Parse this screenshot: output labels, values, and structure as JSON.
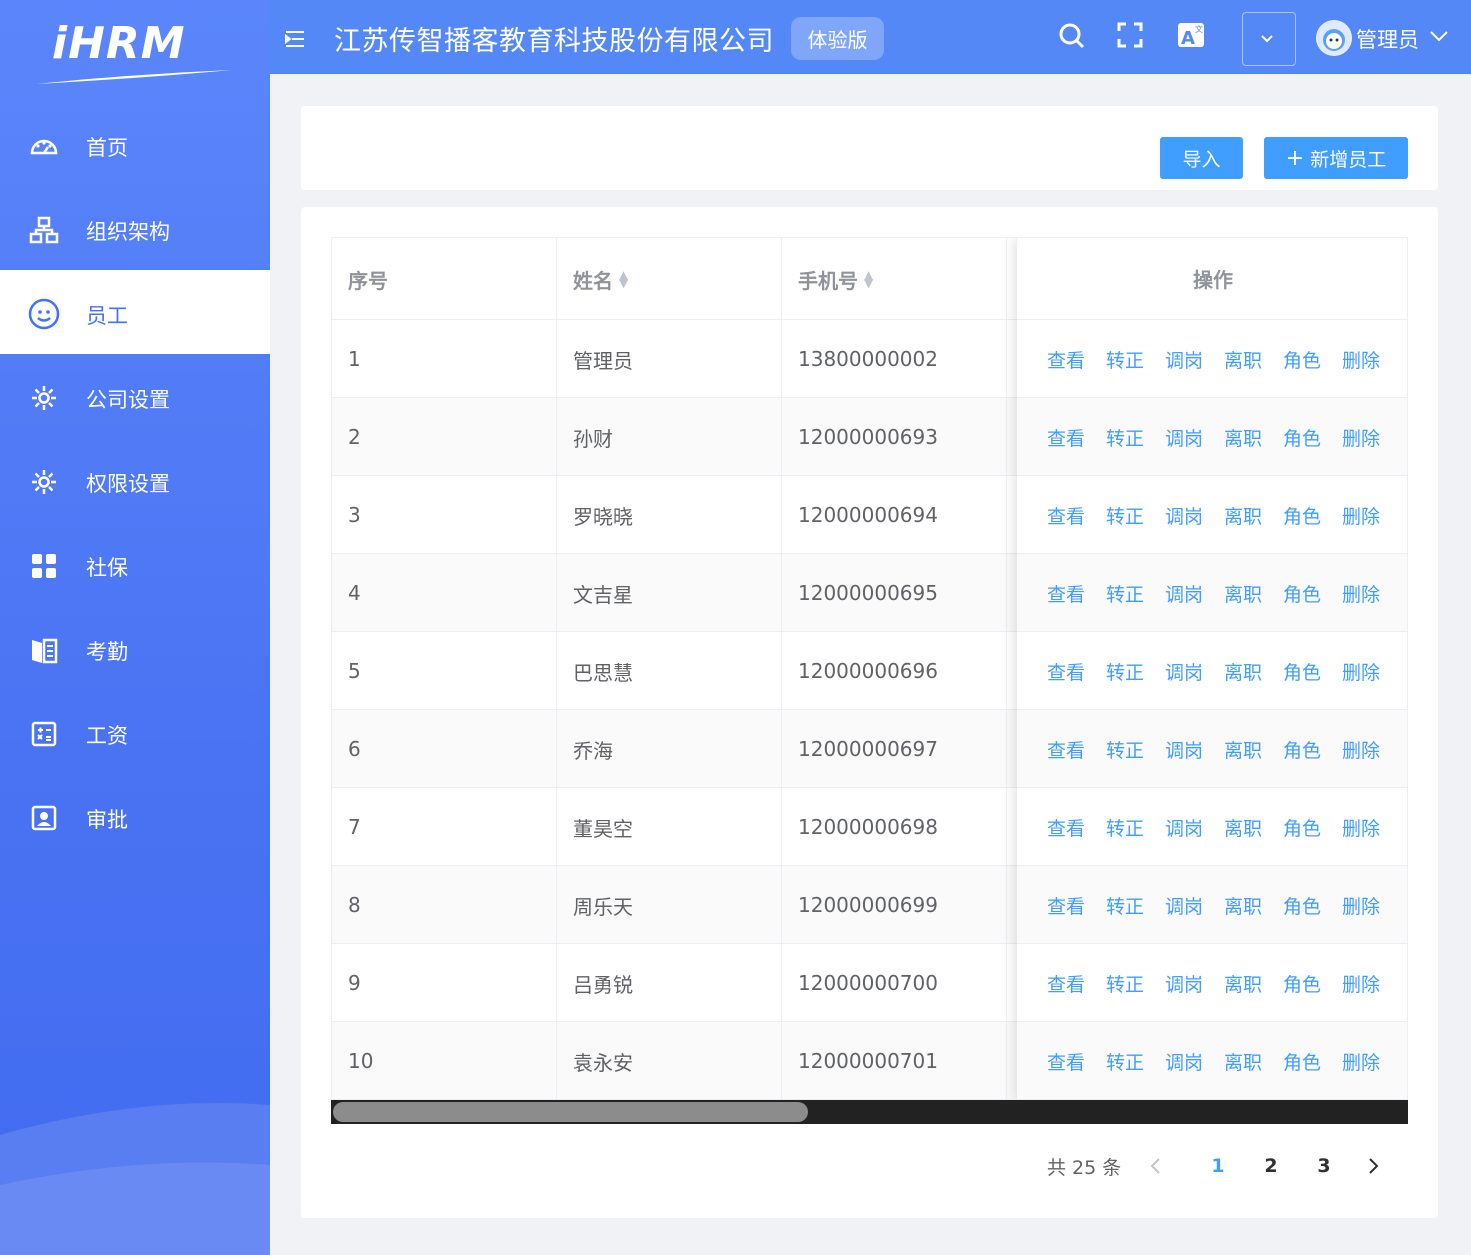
{
  "sidebar": {
    "logo_text": "iHRM",
    "items": [
      {
        "label": "首页",
        "icon": "dashboard-icon"
      },
      {
        "label": "组织架构",
        "icon": "org-chart-icon"
      },
      {
        "label": "员工",
        "icon": "people-icon"
      },
      {
        "label": "公司设置",
        "icon": "gear-icon"
      },
      {
        "label": "权限设置",
        "icon": "gear-icon"
      },
      {
        "label": "社保",
        "icon": "grid-icon"
      },
      {
        "label": "考勤",
        "icon": "book-icon"
      },
      {
        "label": "工资",
        "icon": "calculator-icon"
      },
      {
        "label": "审批",
        "icon": "id-card-icon"
      }
    ],
    "active_index": 2
  },
  "navbar": {
    "company": "江苏传智播客教育科技股份有限公司",
    "trial_tag": "体验版",
    "user_name": "管理员"
  },
  "toolbar": {
    "import_label": "导入",
    "add_label": "新增员工"
  },
  "table": {
    "columns": [
      "序号",
      "姓名",
      "手机号"
    ],
    "op_header": "操作",
    "op_labels": [
      "查看",
      "转正",
      "调岗",
      "离职",
      "角色",
      "删除"
    ],
    "rows": [
      {
        "index": "1",
        "name": "管理员",
        "phone": "13800000002"
      },
      {
        "index": "2",
        "name": "孙财",
        "phone": "12000000693"
      },
      {
        "index": "3",
        "name": "罗晓晓",
        "phone": "12000000694"
      },
      {
        "index": "4",
        "name": "文吉星",
        "phone": "12000000695"
      },
      {
        "index": "5",
        "name": "巴思慧",
        "phone": "12000000696"
      },
      {
        "index": "6",
        "name": "乔海",
        "phone": "12000000697"
      },
      {
        "index": "7",
        "name": "董昊空",
        "phone": "12000000698"
      },
      {
        "index": "8",
        "name": "周乐天",
        "phone": "12000000699"
      },
      {
        "index": "9",
        "name": "吕勇锐",
        "phone": "12000000700"
      },
      {
        "index": "10",
        "name": "袁永安",
        "phone": "12000000701"
      }
    ]
  },
  "pagination": {
    "total_text": "共 25 条",
    "pages": [
      "1",
      "2",
      "3"
    ],
    "current": "1"
  },
  "colors": {
    "sidebar": "#4a73f3",
    "navbar": "#5588f7",
    "primary": "#409eff"
  }
}
